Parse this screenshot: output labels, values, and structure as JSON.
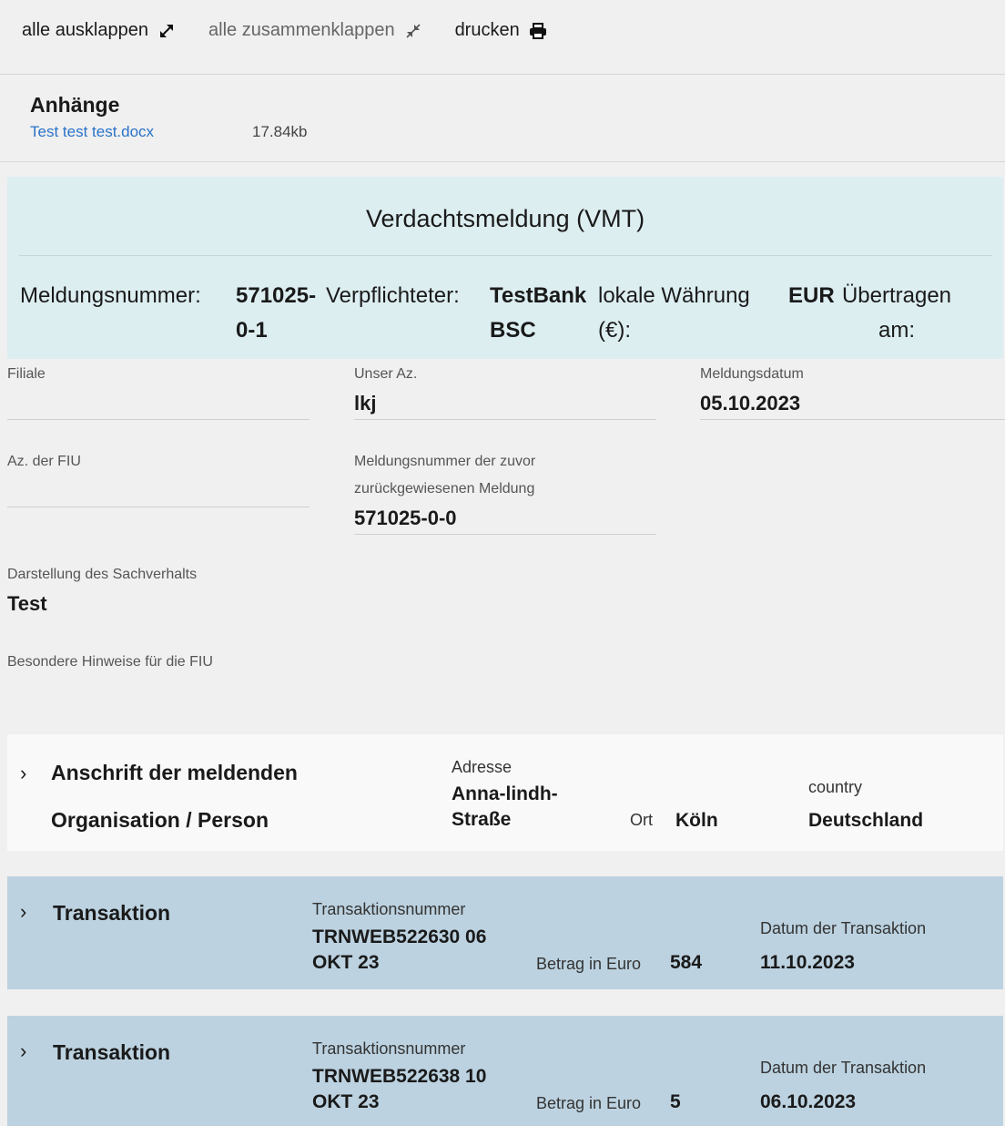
{
  "toolbar": {
    "expand_all": "alle ausklappen",
    "collapse_all": "alle zusammenklappen",
    "print": "drucken"
  },
  "attachments": {
    "heading": "Anhänge",
    "files": [
      {
        "name": "Test test test.docx",
        "size": "17.84kb"
      }
    ]
  },
  "report": {
    "title": "Verdachtsmeldung (VMT)",
    "meta": {
      "number_label": "Meldungsnummer:",
      "number_value": "571025-0-1",
      "obliged_label": "Verpflichteter:",
      "obliged_value": "TestBank BSC",
      "currency_label": "lokale Währung (€):",
      "currency_value": "EUR",
      "transferred_label": "Übertragen am:"
    },
    "fields": {
      "branch": {
        "label": "Filiale",
        "value": ""
      },
      "our_ref": {
        "label": "Unser Az.",
        "value": "lkj"
      },
      "report_date": {
        "label": "Meldungsdatum",
        "value": "05.10.2023"
      },
      "fiu_ref": {
        "label": "Az. der FIU",
        "value": ""
      },
      "prev_number": {
        "label": "Meldungsnummer der zuvor zurückgewiesenen Meldung",
        "value": "571025-0-0"
      },
      "facts": {
        "label": "Darstellung des Sachverhalts",
        "value": "Test"
      },
      "notes": {
        "label": "Besondere Hinweise für die FIU",
        "value": ""
      }
    }
  },
  "address_panel": {
    "title": "Anschrift der meldenden Organisation / Person",
    "address_label": "Adresse",
    "address_value": "Anna-lindh-Straße",
    "city_label": "Ort",
    "city_value": "Köln",
    "country_label": "country",
    "country_value": "Deutschland"
  },
  "transactions": [
    {
      "title": "Transaktion",
      "number_label": "Transaktionsnummer",
      "number_value": "TRNWEB522630 06 OKT 23",
      "amount_label": "Betrag in Euro",
      "amount_value": "584",
      "date_label": "Datum der Transaktion",
      "date_value": "11.10.2023"
    },
    {
      "title": "Transaktion",
      "number_label": "Transaktionsnummer",
      "number_value": "TRNWEB522638 10 OKT 23",
      "amount_label": "Betrag in Euro",
      "amount_value": "5",
      "date_label": "Datum der Transaktion",
      "date_value": "06.10.2023"
    }
  ]
}
